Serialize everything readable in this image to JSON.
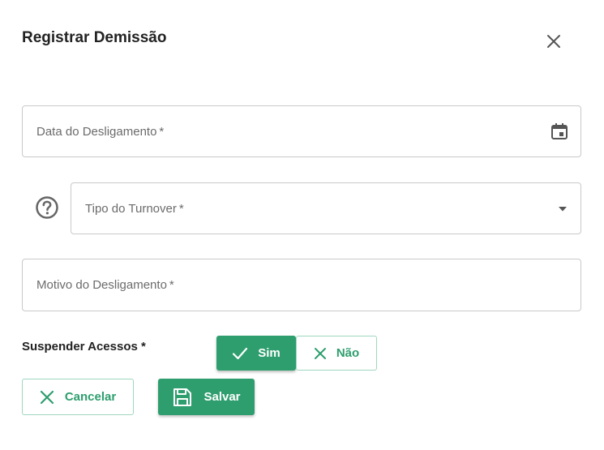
{
  "dialog": {
    "title": "Registrar Demissão",
    "close_icon": "close-icon"
  },
  "fields": {
    "data_desligamento": {
      "label": "Data do Desligamento",
      "required_mark": "*",
      "icon": "calendar-icon"
    },
    "tipo_turnover": {
      "label": "Tipo do Turnover",
      "required_mark": "*",
      "icon": "chevron-down-icon",
      "help_icon": "help-circle-icon"
    },
    "motivo_desligamento": {
      "label": "Motivo do Desligamento",
      "required_mark": "*"
    }
  },
  "suspender_acessos": {
    "label": "Suspender Acessos *",
    "options": [
      {
        "label": "Sim",
        "icon": "check-icon",
        "selected": true
      },
      {
        "label": "Não",
        "icon": "x-icon",
        "selected": false
      }
    ]
  },
  "actions": {
    "cancel_label": "Cancelar",
    "cancel_icon": "x-icon",
    "save_label": "Salvar",
    "save_icon": "save-icon"
  },
  "colors": {
    "accent": "#2e9e6e",
    "accent_border": "#9fd6bf",
    "field_border": "#c9c9c9",
    "placeholder": "#6b6b6b"
  }
}
